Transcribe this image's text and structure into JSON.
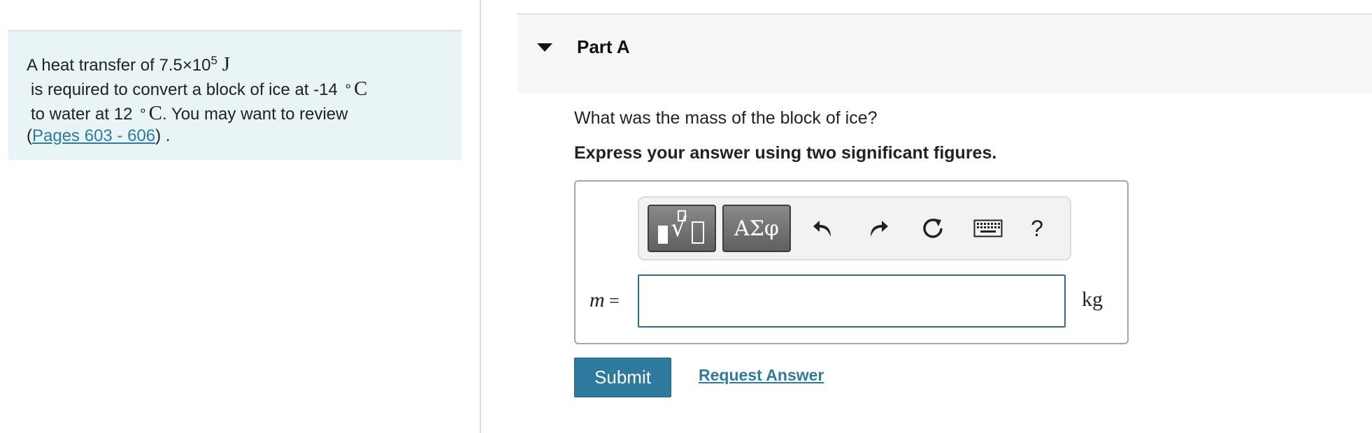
{
  "problem": {
    "line1_prefix": "A heat transfer of ",
    "heat_value": "7.5×10",
    "heat_exponent": "5",
    "heat_unit": "J",
    "line2_prefix": "is required to convert a block of ice at ",
    "initial_temp": "-14",
    "temp_unit": "C",
    "line3_prefix": "to water at ",
    "final_temp": "12",
    "line3_suffix": ". You may want to review",
    "open_paren": "(",
    "review_link": "Pages 603 - 606",
    "close_paren": ") ."
  },
  "part": {
    "title": "Part A",
    "question": "What was the mass of the block of ice?",
    "instruction": "Express your answer using two significant figures."
  },
  "toolbar": {
    "templates_icon": "templates-sqrt-icon",
    "symbols_label": "ΑΣφ",
    "undo_icon": "undo-icon",
    "redo_icon": "redo-icon",
    "reset_icon": "reset-icon",
    "keyboard_icon": "keyboard-icon",
    "help_label": "?"
  },
  "answer": {
    "variable": "m",
    "equals": "=",
    "value": "",
    "unit": "kg"
  },
  "actions": {
    "submit_label": "Submit",
    "request_answer_label": "Request Answer"
  },
  "colors": {
    "problem_bg": "#e8f4f6",
    "accent": "#2e7a9e",
    "link": "#2e7aa0"
  }
}
